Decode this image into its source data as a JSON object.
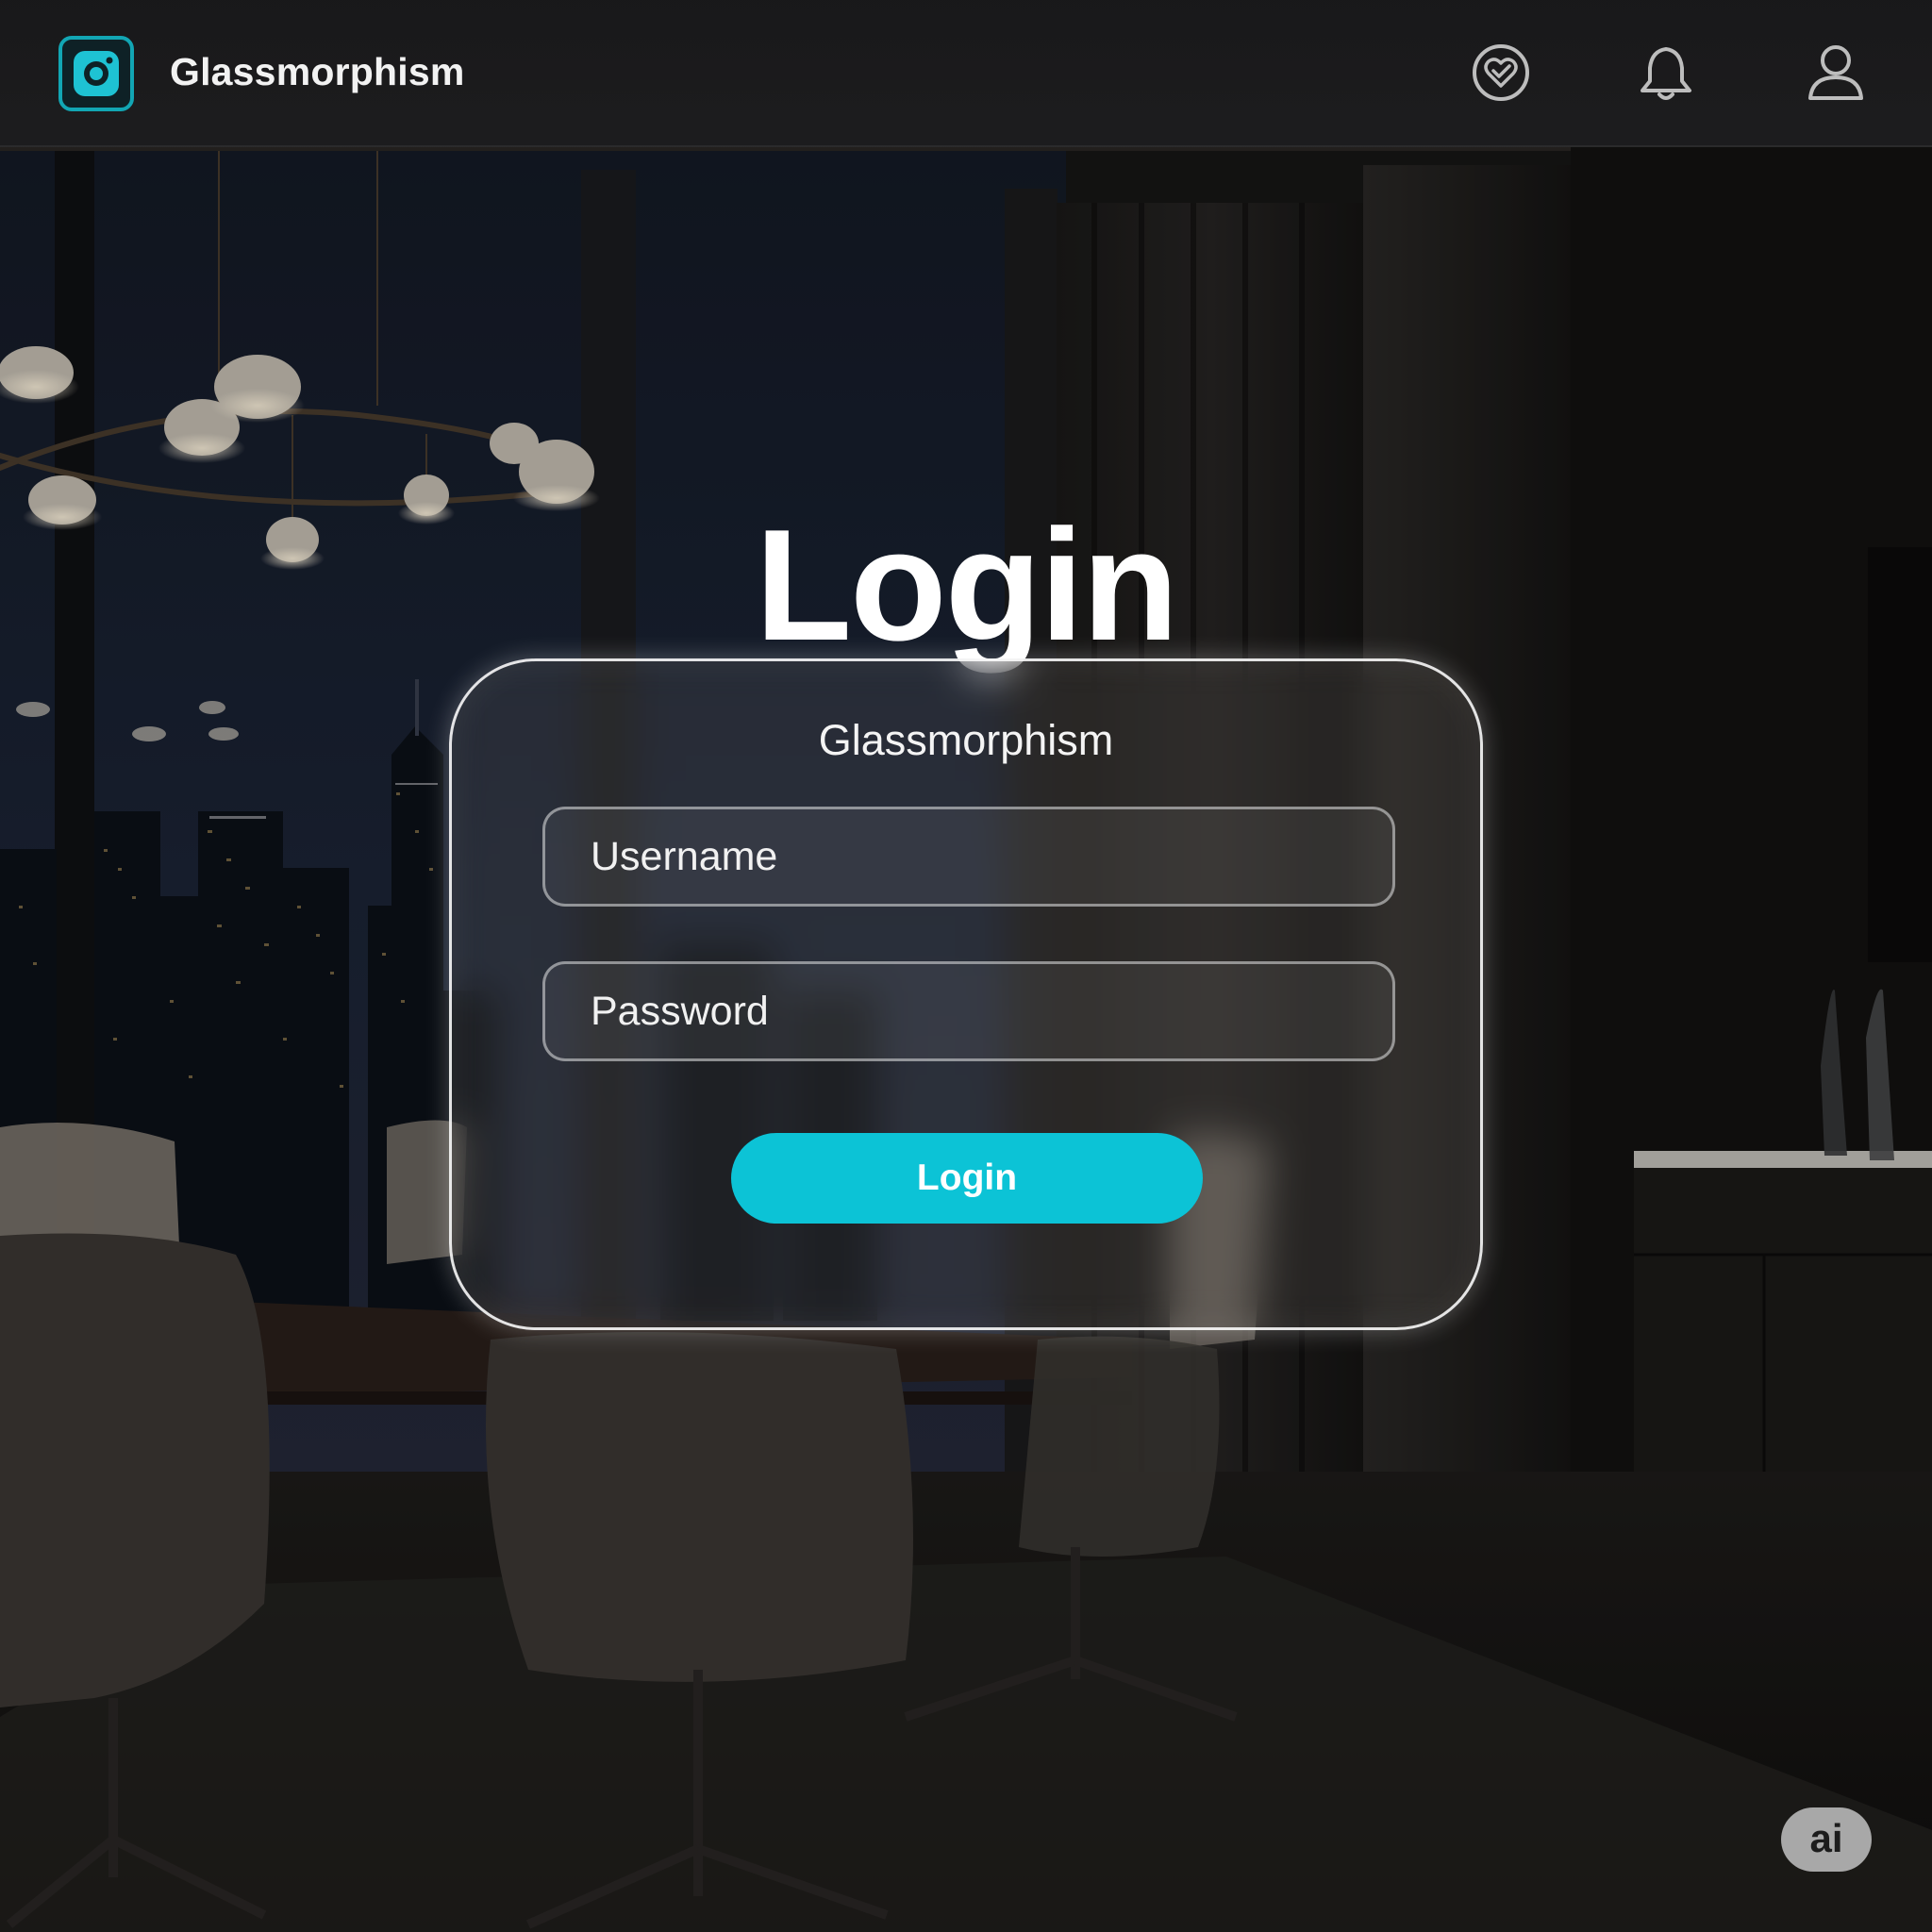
{
  "header": {
    "logo_icon": "camera-icon",
    "title": "Glassmorphism",
    "icons": [
      "heart-check-icon",
      "bell-icon",
      "user-icon"
    ]
  },
  "main": {
    "heading": "Login",
    "card": {
      "subtitle": "Glassmorphism",
      "username_placeholder": "Username",
      "password_placeholder": "Password",
      "login_button_label": "Login"
    }
  },
  "badge": {
    "label": "ai"
  },
  "colors": {
    "accent": "#0cc3d6",
    "logo_border": "#12a6b4",
    "card_border": "#ffffff",
    "topbar": "#1a1a1c"
  }
}
